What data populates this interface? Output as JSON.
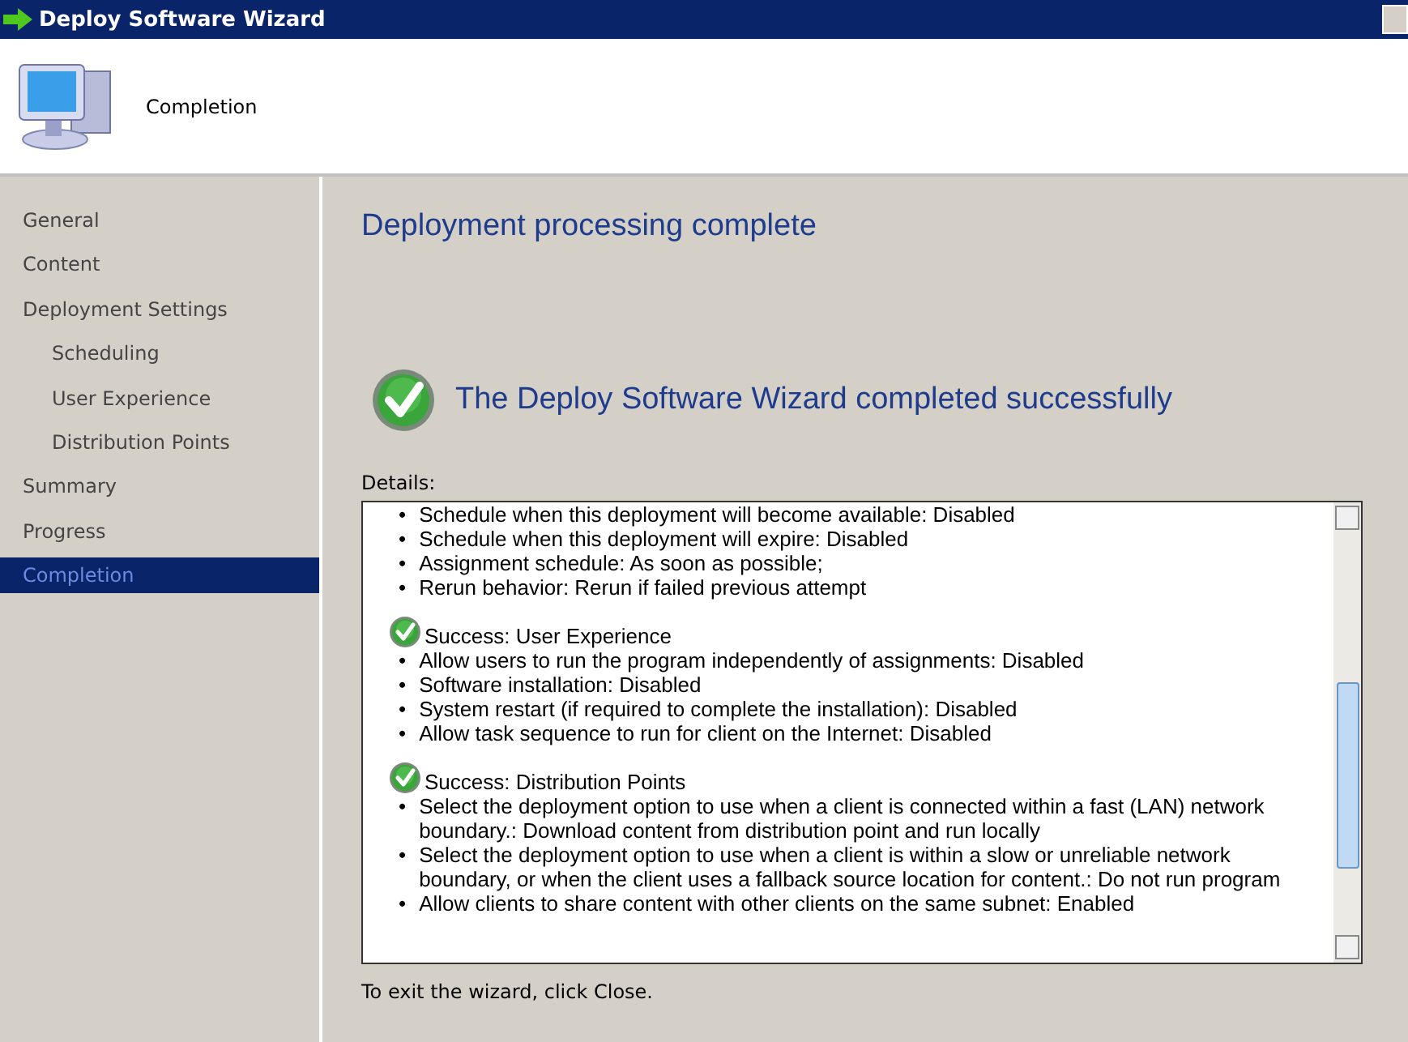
{
  "window": {
    "title": "Deploy Software Wizard"
  },
  "header": {
    "title": "Completion"
  },
  "sidebar": {
    "items": [
      {
        "label": "General",
        "selected": false
      },
      {
        "label": "Content",
        "selected": false
      },
      {
        "label": "Deployment Settings",
        "selected": false,
        "children": [
          {
            "label": "Scheduling",
            "selected": false
          },
          {
            "label": "User Experience",
            "selected": false
          },
          {
            "label": "Distribution Points",
            "selected": false
          }
        ]
      },
      {
        "label": "Summary",
        "selected": false
      },
      {
        "label": "Progress",
        "selected": false
      },
      {
        "label": "Completion",
        "selected": true
      }
    ]
  },
  "main": {
    "heading": "Deployment processing complete",
    "status": "The Deploy Software Wizard completed successfully",
    "details_label": "Details:",
    "details": [
      {
        "kind": "list",
        "items": [
          {
            "bullet": "•",
            "text": "Schedule when this deployment will become available: Disabled"
          },
          {
            "bullet": "•",
            "text": "Schedule when this deployment will expire: Disabled"
          },
          {
            "bullet": "•",
            "text": "Assignment schedule: As soon as possible;"
          },
          {
            "bullet": "•",
            "text": "Rerun behavior: Rerun if failed previous attempt"
          }
        ]
      },
      {
        "kind": "success",
        "title": "Success: User Experience",
        "items": [
          {
            "bullet": "•",
            "text": "Allow users to run the program independently of assignments: Disabled"
          },
          {
            "bullet": "•",
            "text": "Software installation: Disabled"
          },
          {
            "bullet": "•",
            "text": "System restart (if required to complete the installation): Disabled"
          },
          {
            "bullet": "•",
            "text": "Allow task sequence to run for client on the Internet: Disabled"
          }
        ]
      },
      {
        "kind": "success",
        "title": "Success: Distribution Points",
        "items": [
          {
            "bullet": "•",
            "text": "Select the deployment option to use when a client is connected within a fast (LAN) network boundary.: Download content from distribution point and run locally"
          },
          {
            "bullet": "•",
            "text": "Select the deployment option to use when a client is within a slow or unreliable network boundary, or when the client uses a fallback source location for content.: Do not run program"
          },
          {
            "bullet": "•",
            "text": "Allow clients to share content with other clients on the same subnet: Enabled"
          }
        ]
      }
    ],
    "footer": "To exit the wizard, click Close."
  }
}
